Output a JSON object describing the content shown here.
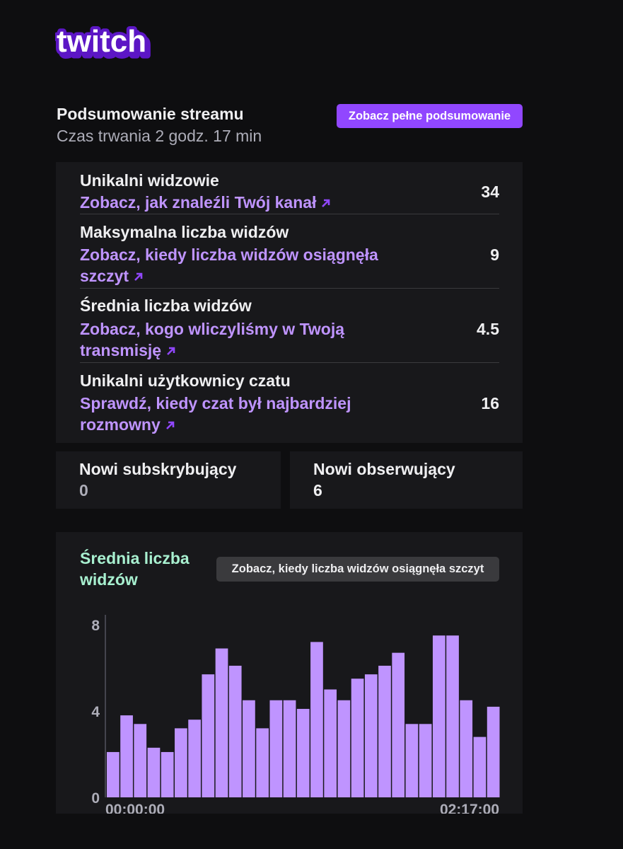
{
  "brand": {
    "name": "twitch",
    "color": "#9147ff"
  },
  "summary": {
    "title": "Podsumowanie streamu",
    "duration": "Czas trwania 2 godz. 17 min",
    "full_summary_button": "Zobacz pełne podsumowanie"
  },
  "stats": [
    {
      "label": "Unikalni widzowie",
      "link": "Zobacz, jak znaleźli Twój kanał",
      "value": "34"
    },
    {
      "label": "Maksymalna liczba widzów",
      "link": "Zobacz, kiedy liczba widzów osiągnęła szczyt",
      "value": "9"
    },
    {
      "label": "Średnia liczba widzów",
      "link": "Zobacz, kogo wliczyliśmy w Twoją transmisję",
      "value": "4.5"
    },
    {
      "label": "Unikalni użytkownicy czatu",
      "link": "Sprawdź, kiedy czat był najbardziej rozmowny",
      "value": "16"
    }
  ],
  "new_subscribers": {
    "label": "Nowi subskrybujący",
    "value": "0"
  },
  "new_followers": {
    "label": "Nowi obserwujący",
    "value": "6"
  },
  "chart": {
    "title": "Średnia liczba widzów",
    "peak_button": "Zobacz, kiedy liczba widzów osiągnęła szczyt"
  },
  "chart_data": {
    "type": "bar",
    "title": "Średnia liczba widzów",
    "ylim": [
      0,
      8
    ],
    "yticks": [
      "0",
      "4",
      "8"
    ],
    "xticks": [
      "00:00:00",
      "02:17:00"
    ],
    "values": [
      2.1,
      3.8,
      3.4,
      2.3,
      2.1,
      3.2,
      3.6,
      5.7,
      6.9,
      6.1,
      4.5,
      3.2,
      4.5,
      4.5,
      4.1,
      7.2,
      5.0,
      4.5,
      5.5,
      5.7,
      6.1,
      6.7,
      3.4,
      3.4,
      7.5,
      7.5,
      4.5,
      2.8,
      4.2
    ],
    "bar_color": "#bf94ff",
    "grid": false
  },
  "colors": {
    "background": "#0e0e10",
    "panel": "#18181b",
    "accent": "#9147ff",
    "link": "#bf94ff",
    "chart_title": "#a8f0d0"
  }
}
